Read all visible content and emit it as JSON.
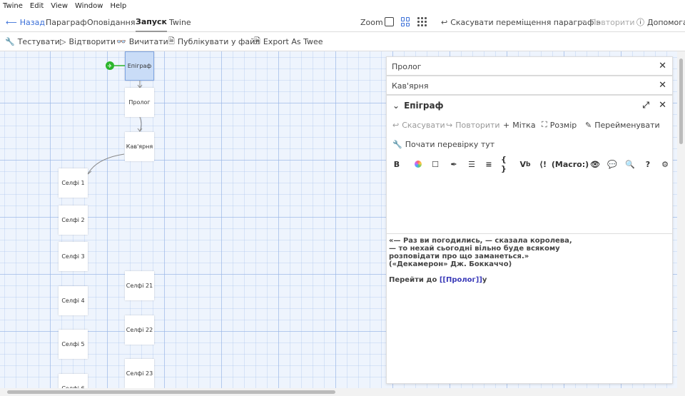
{
  "menubar": [
    "Twine",
    "Edit",
    "View",
    "Window",
    "Help"
  ],
  "topbar": {
    "back": "Назад",
    "tabs": [
      "Параграф",
      "Оповідання",
      "Запуск",
      "Twine"
    ],
    "active_tab": "Запуск",
    "zoom_label": "Zoom",
    "undo_move": "Скасувати переміщення параграфів",
    "redo": "Повторити",
    "help": "Допомога"
  },
  "toolbar2": {
    "test": "Тестувати",
    "play": "Відтворити",
    "proof": "Вичитати",
    "publish": "Публікувати у файл",
    "export": "Export As Twee"
  },
  "passages": [
    {
      "name": "Епіграф",
      "selected": true
    },
    {
      "name": "Пролог"
    },
    {
      "name": "Кав'ярня"
    },
    {
      "name": "Селфі 1"
    },
    {
      "name": "Селфі 2"
    },
    {
      "name": "Селфі 3"
    },
    {
      "name": "Селфі 4"
    },
    {
      "name": "Селфі 5"
    },
    {
      "name": "Селфі 6"
    },
    {
      "name": "Селфі 21"
    },
    {
      "name": "Селфі 22"
    },
    {
      "name": "Селфі 23"
    }
  ],
  "dialogs": {
    "collapsed": [
      "Пролог",
      "Кав'ярня"
    ],
    "main": {
      "title": "Епіграф",
      "undo": "Скасувати",
      "redo": "Повторити",
      "tag": "Мітка",
      "size": "Розмір",
      "rename": "Перейменувати",
      "test_from_here": "Почати перевірку тут",
      "macro_label": "(Macro:)",
      "text_lines": [
        "«— Раз ви погодились, — сказала королева,",
        "— то нехай сьогодні вільно буде всякому",
        "розповідати про що заманеться.»",
        "(«Декамерон» Дж. Боккаччо)"
      ],
      "link_prefix": "Перейти до ",
      "link_open": "[[",
      "link_target": "Пролог",
      "link_close": "]]",
      "link_suffix": "у"
    }
  },
  "colors": {
    "accent": "#3a6fd8",
    "start_badge": "#2ab52a",
    "selected_passage": "#c9dcf7",
    "grid_background": "#eef4fd"
  }
}
